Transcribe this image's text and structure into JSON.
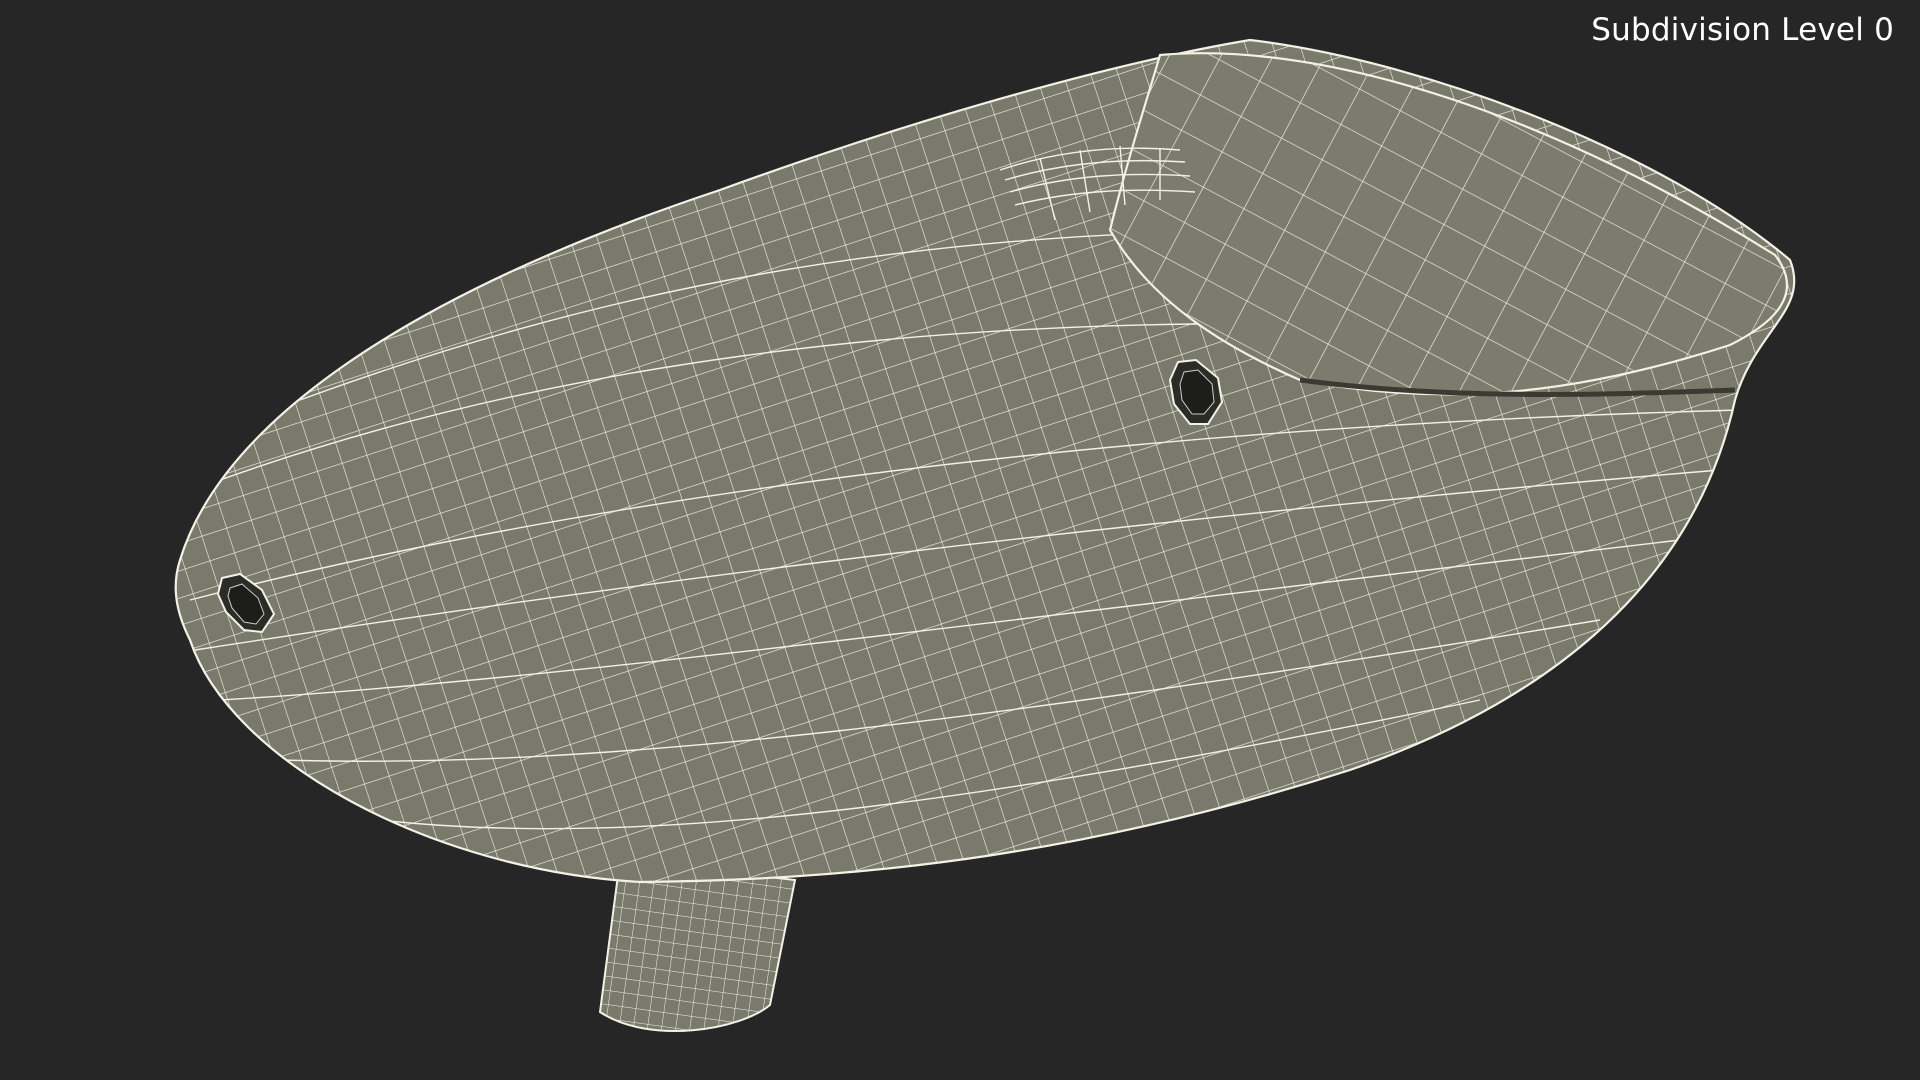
{
  "viewport": {
    "overlay_label": "Subdivision Level 0",
    "background_color": "#262626",
    "model": {
      "object": "3D wireframe render of a hopper-like shell",
      "surface_color": "#7a7a6c",
      "wire_color": "#f2f1e6",
      "features": [
        "lid-panel",
        "side-hole",
        "end-hole",
        "feed-neck"
      ]
    }
  }
}
